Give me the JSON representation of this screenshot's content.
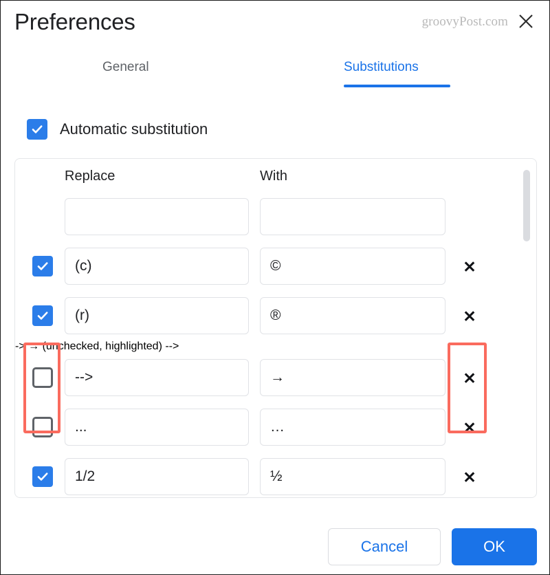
{
  "header": {
    "title": "Preferences",
    "watermark": "groovyPost.com",
    "close_icon": "close-icon"
  },
  "tabs": [
    {
      "label": "General",
      "active": false
    },
    {
      "label": "Substitutions",
      "active": true
    }
  ],
  "auto_substitution": {
    "label": "Automatic substitution",
    "checked": true
  },
  "table": {
    "columns": {
      "replace": "Replace",
      "with": "With"
    },
    "new_row": {
      "replace_value": "",
      "with_value": "",
      "replace_placeholder": "",
      "with_placeholder": ""
    },
    "rows": [
      {
        "checked": true,
        "replace": "(c)",
        "with": "©",
        "delete_label": "✕",
        "highlighted": false
      },
      {
        "checked": true,
        "replace": "(r)",
        "with": "®",
        "delete_label": "✕",
        "highlighted": false
      },
      {
        "checked": false,
        "replace": "-->",
        "with": "→",
        "delete_label": "✕",
        "highlighted": true
      },
      {
        "checked": false,
        "replace": "...",
        "with": "…",
        "delete_label": "✕",
        "highlighted": true
      },
      {
        "checked": true,
        "replace": "1/2",
        "with": "½",
        "delete_label": "✕",
        "highlighted": false
      },
      {
        "checked": false,
        "replace": "",
        "with": "",
        "delete_label": "",
        "highlighted": false
      }
    ]
  },
  "footer": {
    "cancel_label": "Cancel",
    "ok_label": "OK"
  },
  "colors": {
    "accent_blue": "#1a73e8",
    "checkbox_blue": "#2b7de9",
    "highlight_red": "#fa6b5e",
    "text_primary": "#202124",
    "text_muted": "#5f6368",
    "border_light": "#e0e2e6",
    "scrollbar": "#dadce0"
  }
}
